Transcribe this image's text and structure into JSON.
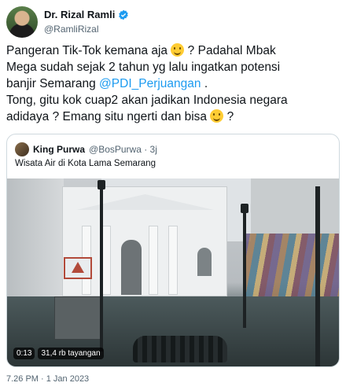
{
  "author": {
    "name": "Dr. Rizal Ramli",
    "handle": "@RamliRizal",
    "verified": true
  },
  "tweet": {
    "line1a": "Pangeran Tik-Tok kemana aja ",
    "line1b": " ? Padahal Mbak",
    "line2": "Mega sudah sejak 2 tahun yg lalu ingatkan potensi",
    "line3a": "banjir Semarang ",
    "line3_mention": "@PDI_Perjuangan",
    "line3b": " .",
    "line4": "Tong, gitu kok cuap2 akan jadikan Indonesia negara",
    "line5a": "adidaya ? Emang situ ngerti dan bisa ",
    "line5b": " ?",
    "emoji": "slightly-smiling-face"
  },
  "quote": {
    "name": "King Purwa",
    "meta": "@BosPurwa · 3j",
    "text": "Wisata Air di Kota Lama Semarang",
    "video": {
      "duration": "0:13",
      "views": "31,4 rb tayangan"
    }
  },
  "timestamp": "7.26 PM · 1 Jan 2023",
  "colors": {
    "link": "#1d9bf0",
    "verified": "#1d9bf0",
    "muted": "#536471",
    "border": "#cfd9de"
  }
}
